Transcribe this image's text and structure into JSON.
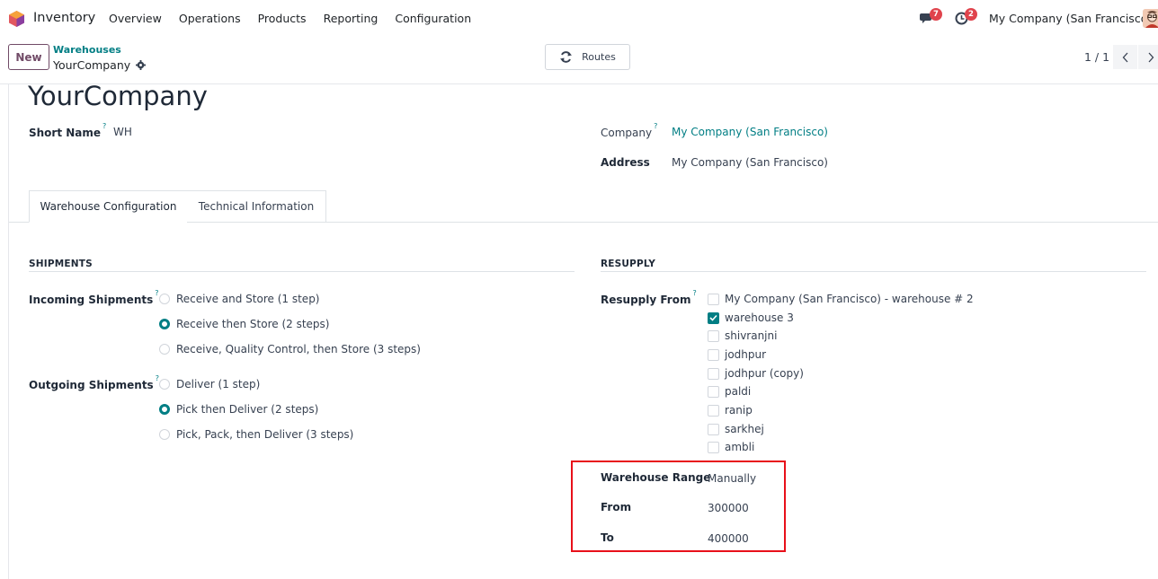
{
  "nav": {
    "app_name": "Inventory",
    "menu": [
      "Overview",
      "Operations",
      "Products",
      "Reporting",
      "Configuration"
    ],
    "messages_badge": "7",
    "activities_badge": "2",
    "company": "My Company (San Francisco)"
  },
  "control": {
    "new_label": "New",
    "breadcrumb_parent": "Warehouses",
    "breadcrumb_current": "YourCompany",
    "routes_label": "Routes",
    "pager": "1 / 1"
  },
  "record": {
    "title": "YourCompany",
    "short_name_label": "Short Name",
    "short_name_value": "WH",
    "company_label": "Company",
    "company_value": "My Company (San Francisco)",
    "address_label": "Address",
    "address_value": "My Company (San Francisco)"
  },
  "tabs": [
    "Warehouse Configuration",
    "Technical Information"
  ],
  "shipments": {
    "title": "SHIPMENTS",
    "incoming_label": "Incoming Shipments",
    "incoming_options": [
      {
        "label": "Receive and Store (1 step)",
        "selected": false
      },
      {
        "label": "Receive then Store (2 steps)",
        "selected": true
      },
      {
        "label": "Receive, Quality Control, then Store (3 steps)",
        "selected": false
      }
    ],
    "outgoing_label": "Outgoing Shipments",
    "outgoing_options": [
      {
        "label": "Deliver (1 step)",
        "selected": false
      },
      {
        "label": "Pick then Deliver (2 steps)",
        "selected": true
      },
      {
        "label": "Pick, Pack, then Deliver (3 steps)",
        "selected": false
      }
    ]
  },
  "resupply": {
    "title": "RESUPPLY",
    "from_label": "Resupply From",
    "warehouses": [
      {
        "label": "My Company (San Francisco) - warehouse # 2",
        "checked": false
      },
      {
        "label": "warehouse 3",
        "checked": true
      },
      {
        "label": "shivranjni",
        "checked": false
      },
      {
        "label": "jodhpur",
        "checked": false
      },
      {
        "label": "jodhpur (copy)",
        "checked": false
      },
      {
        "label": "paldi",
        "checked": false
      },
      {
        "label": "ranip",
        "checked": false
      },
      {
        "label": "sarkhej",
        "checked": false
      },
      {
        "label": "ambli",
        "checked": false
      }
    ]
  },
  "range": {
    "range_label": "Warehouse Range",
    "range_value": "Manually",
    "from_label": "From",
    "from_value": "300000",
    "to_label": "To",
    "to_value": "400000"
  },
  "colors": {
    "accent": "#017e84",
    "brand": "#714b67",
    "badge": "#e0434c",
    "highlight": "#e8101a"
  }
}
